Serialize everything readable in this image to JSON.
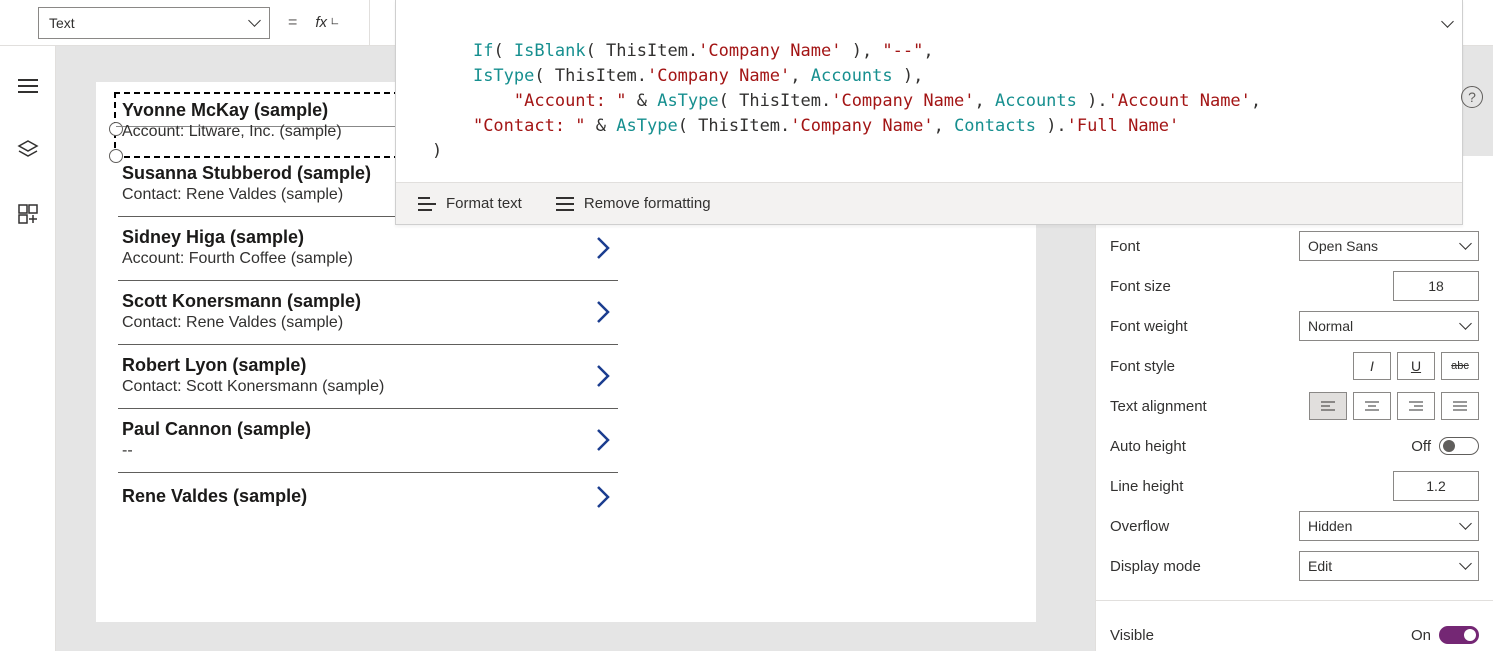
{
  "topbar": {
    "property": "Text",
    "equals": "=",
    "fx": "fx"
  },
  "formula": {
    "l1a": "If",
    "l1b": "(",
    "l1c": " IsBlank",
    "l1d": "( ThisItem.",
    "l1e": "'Company Name'",
    "l1f": " ), ",
    "l1g": "\"--\"",
    "l1h": ",",
    "l2a": "IsType",
    "l2b": "( ThisItem.",
    "l2c": "'Company Name'",
    "l2d": ", ",
    "l2e": "Accounts",
    "l2f": " ),",
    "l3a": "\"Account: \"",
    "l3b": " & ",
    "l3c": "AsType",
    "l3d": "( ThisItem.",
    "l3e": "'Company Name'",
    "l3f": ", ",
    "l3g": "Accounts",
    "l3h": " ).",
    "l3i": "'Account Name'",
    "l3j": ",",
    "l4a": "\"Contact: \"",
    "l4b": " & ",
    "l4c": "AsType",
    "l4d": "( ThisItem.",
    "l4e": "'Company Name'",
    "l4f": ", ",
    "l4g": "Contacts",
    "l4h": " ).",
    "l4i": "'Full Name'",
    "l5": ")",
    "format": "Format text",
    "remove": "Remove formatting"
  },
  "gallery": {
    "items": [
      {
        "title": "Yvonne McKay (sample)",
        "sub": "Account: Litware, Inc. (sample)"
      },
      {
        "title": "Susanna Stubberod (sample)",
        "sub": "Contact: Rene Valdes (sample)"
      },
      {
        "title": "Sidney Higa (sample)",
        "sub": "Account: Fourth Coffee (sample)"
      },
      {
        "title": "Scott Konersmann (sample)",
        "sub": "Contact: Rene Valdes (sample)"
      },
      {
        "title": "Robert Lyon (sample)",
        "sub": "Contact: Scott Konersmann (sample)"
      },
      {
        "title": "Paul Cannon (sample)",
        "sub": "--"
      },
      {
        "title": "Rene Valdes (sample)",
        "sub": ""
      }
    ]
  },
  "props": {
    "text_sample": "(sample)",
    "font_label": "Font",
    "font_value": "Open Sans",
    "fontsize_label": "Font size",
    "fontsize_value": "18",
    "fontweight_label": "Font weight",
    "fontweight_value": "Normal",
    "fontstyle_label": "Font style",
    "align_label": "Text alignment",
    "autoheight_label": "Auto height",
    "autoheight_value": "Off",
    "lineheight_label": "Line height",
    "lineheight_value": "1.2",
    "overflow_label": "Overflow",
    "overflow_value": "Hidden",
    "displaymode_label": "Display mode",
    "displaymode_value": "Edit",
    "visible_label": "Visible",
    "visible_value": "On"
  }
}
